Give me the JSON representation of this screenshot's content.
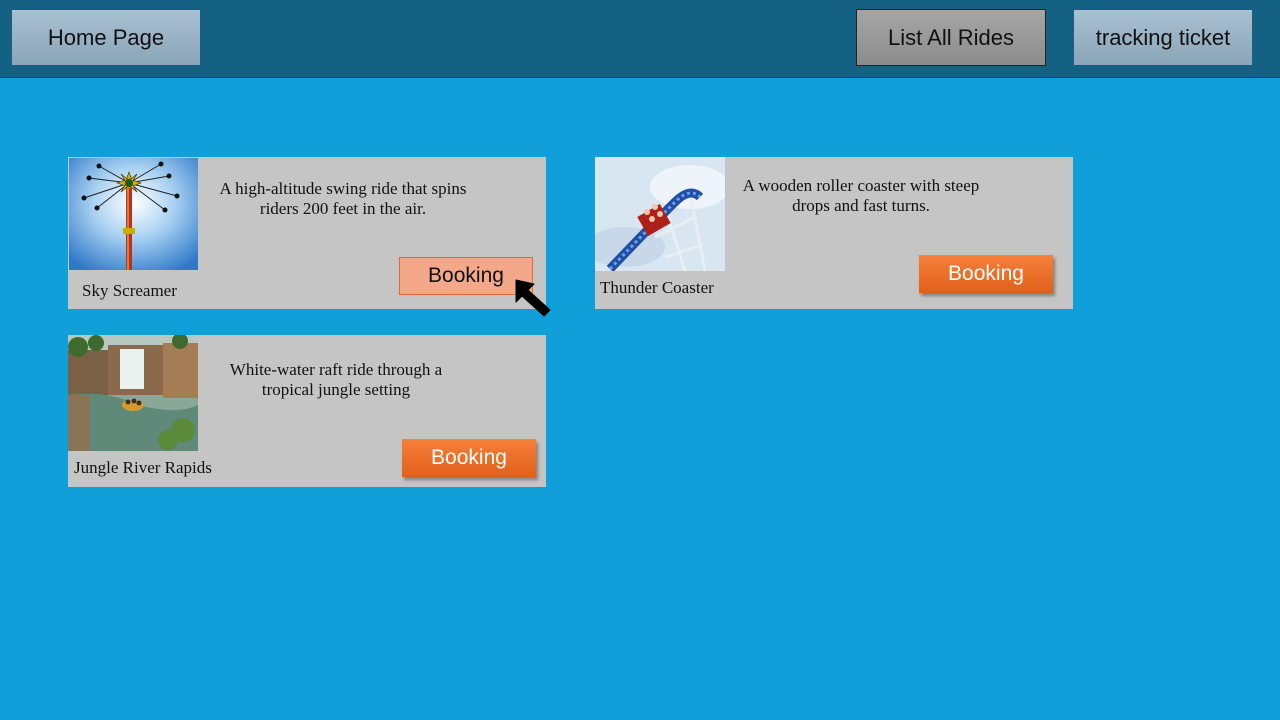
{
  "nav": {
    "home_label": "Home Page",
    "list_rides_label": "List All Rides",
    "tracking_label": "tracking ticket"
  },
  "rides": [
    {
      "name": "Sky Screamer",
      "description": "A high-altitude swing ride that spins riders 200 feet in the air.",
      "booking_label": "Booking",
      "image": "swing-ride-tower-photo"
    },
    {
      "name": "Thunder Coaster",
      "description": "A wooden roller coaster with steep drops and fast turns.",
      "booking_label": "Booking",
      "image": "roller-coaster-photo"
    },
    {
      "name": "Jungle River Rapids",
      "description": "White-water raft ride through a tropical jungle setting",
      "booking_label": "Booking",
      "image": "river-rapids-photo"
    }
  ],
  "colors": {
    "page_background": "#109fd8",
    "topbar": "#156184",
    "card": "#c5c5c5",
    "booking_button": "#e8692a",
    "booking_button_hover": "#f4a88a"
  },
  "icons": {
    "cursor": "pointer-arrow-icon"
  }
}
